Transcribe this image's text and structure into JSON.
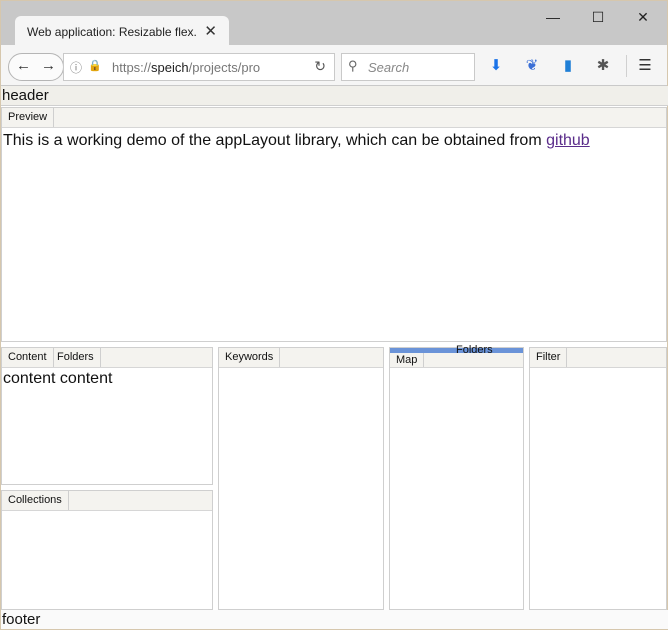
{
  "browser": {
    "tab_title": "Web application: Resizable flex...",
    "tab_close": "✕",
    "window_controls": {
      "minimize": "—",
      "maximize": "☐",
      "close": "✕"
    },
    "nav": {
      "back": "←",
      "forward": "→"
    },
    "url": {
      "prefix": "https://",
      "domain": "speich",
      "path": "/projects/pro"
    },
    "reload": "↻",
    "search_placeholder": "Search",
    "toolbar_icons": [
      "download-icon",
      "extension-icon",
      "database-icon",
      "bug-icon",
      "menu-icon"
    ],
    "colors": {
      "download": "#1a73e8",
      "extension": "#3b6fd6",
      "database": "#1f7fd6",
      "bug": "#555555"
    }
  },
  "page": {
    "header": "header",
    "preview_tab": "Preview",
    "preview_text": "This is a working demo of the appLayout library, which can be obtained from ",
    "preview_link": "github",
    "content_tabs": [
      "Content",
      "Folders"
    ],
    "content_text": "content content",
    "collections_tab": "Collections",
    "keywords_tab": "Keywords",
    "folders_floating": "Folders",
    "map_tab": "Map",
    "filter_tab": "Filter",
    "footer": "footer",
    "accent_color": "#6a93d8"
  }
}
